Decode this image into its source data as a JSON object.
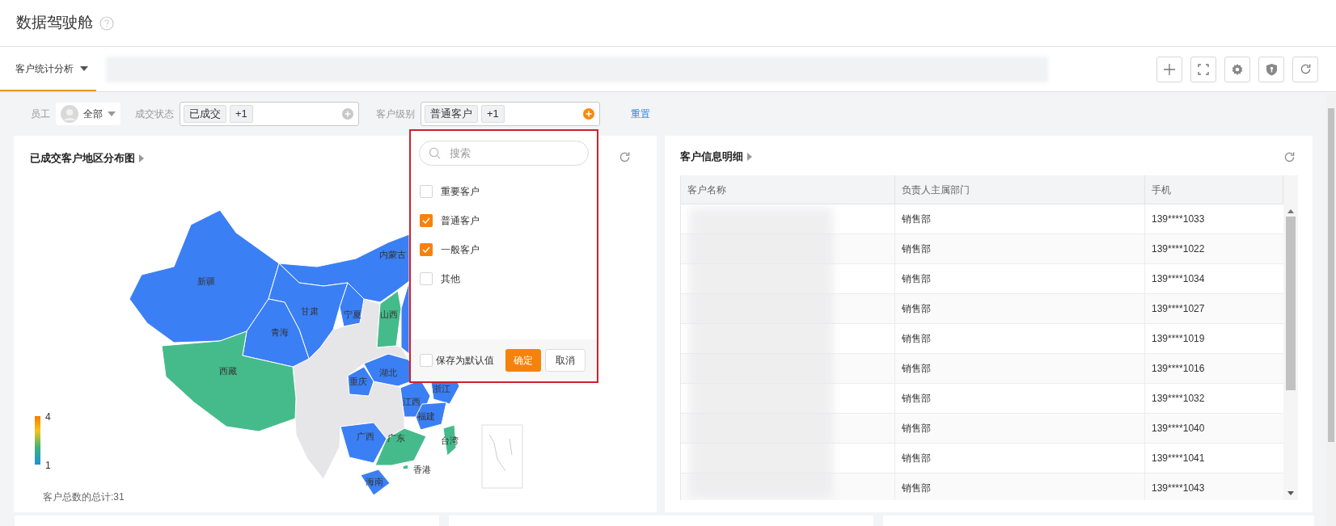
{
  "page": {
    "title": "数据驾驶舱"
  },
  "tabs": [
    {
      "label": "客户统计分析",
      "selected": true
    }
  ],
  "filters": [
    {
      "kind": "user",
      "label": "员工",
      "value": "全部"
    },
    {
      "kind": "tags",
      "label": "成交状态",
      "tags": [
        "已成交",
        "+1"
      ],
      "open": false
    },
    {
      "kind": "tags",
      "label": "客户级别",
      "tags": [
        "普通客户",
        "+1"
      ],
      "open": true
    }
  ],
  "reset": "重置",
  "dropdown": {
    "search_placeholder": "搜索",
    "options": [
      {
        "label": "重要客户",
        "checked": false
      },
      {
        "label": "普通客户",
        "checked": true
      },
      {
        "label": "一般客户",
        "checked": true
      },
      {
        "label": "其他",
        "checked": false
      }
    ],
    "save_default": {
      "label": "保存为默认值",
      "checked": false
    },
    "buttons": [
      {
        "label": "确定",
        "kind": "primary"
      },
      {
        "label": "取消",
        "kind": "secondary"
      }
    ]
  },
  "map_panel": {
    "title": "已成交客户地区分布图",
    "regions": [
      {
        "label": "新疆",
        "color": "#3b7ff5"
      },
      {
        "label": "内蒙古",
        "color": "#3b7ff5"
      },
      {
        "label": "甘肃",
        "color": "#3b7ff5"
      },
      {
        "label": "宁夏",
        "color": "#3b7ff5"
      },
      {
        "label": "青海",
        "color": "#3b7ff5"
      },
      {
        "label": "西藏",
        "color": "#45bb8b"
      },
      {
        "label": "山西",
        "color": "#45bb8b"
      },
      {
        "label": "湖北",
        "color": "#3b7ff5"
      },
      {
        "label": "重庆",
        "color": "#3b7ff5"
      },
      {
        "label": "江西",
        "color": "#3b7ff5"
      },
      {
        "label": "浙江",
        "color": "#3b7ff5"
      },
      {
        "label": "福建",
        "color": "#3b7ff5"
      },
      {
        "label": "广西",
        "color": "#3b7ff5"
      },
      {
        "label": "广东",
        "color": "#45bb8b"
      },
      {
        "label": "香港",
        "color": "#45bb8b"
      },
      {
        "label": "台湾",
        "color": "#45bb8b"
      },
      {
        "label": "海南",
        "color": "#3b7ff5"
      }
    ],
    "legend": {
      "max": "4",
      "min": "1"
    },
    "total": "客户总数的总计:31"
  },
  "table_panel": {
    "title": "客户信息明细",
    "columns": [
      "客户名称",
      "负责人主属部门",
      "手机"
    ],
    "rows": [
      {
        "department": "销售部",
        "phone": "139****1033"
      },
      {
        "department": "销售部",
        "phone": "139****1022"
      },
      {
        "department": "销售部",
        "phone": "139****1034"
      },
      {
        "department": "销售部",
        "phone": "139****1027"
      },
      {
        "department": "销售部",
        "phone": "139****1019"
      },
      {
        "department": "销售部",
        "phone": "139****1016"
      },
      {
        "department": "销售部",
        "phone": "139****1032"
      },
      {
        "department": "销售部",
        "phone": "139****1040"
      },
      {
        "department": "销售部",
        "phone": "139****1041"
      },
      {
        "department": "销售部",
        "phone": "139****1043"
      }
    ]
  }
}
